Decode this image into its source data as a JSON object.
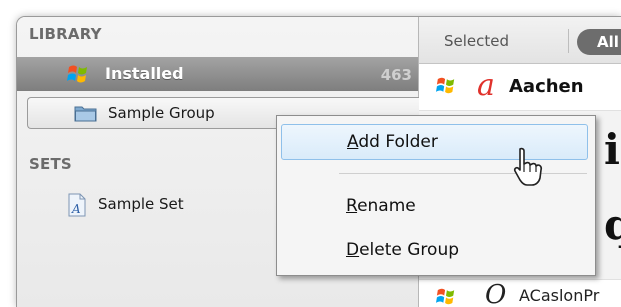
{
  "library": {
    "heading": "LIBRARY",
    "installed": {
      "label": "Installed",
      "count": "463"
    },
    "group": {
      "label": "Sample Group"
    }
  },
  "sets": {
    "heading": "SETS",
    "items": [
      {
        "label": "Sample Set"
      }
    ]
  },
  "toolbar": {
    "selected_label": "Selected",
    "all_label": "All"
  },
  "fonts": [
    {
      "glyph": "a",
      "name": "Aachen"
    },
    {
      "glyph": "O",
      "name": "ACaslonPr"
    }
  ],
  "preview": {
    "line1": "i",
    "line2": "q"
  },
  "context_menu": {
    "items": [
      {
        "mnemonic": "A",
        "rest": "dd Folder",
        "highlighted": true
      },
      {
        "mnemonic": "R",
        "rest": "ename"
      },
      {
        "mnemonic": "D",
        "rest": "elete Group"
      }
    ]
  },
  "colors": {
    "selection_gray": "#8f8f8f",
    "menu_highlight": "#d9ebfa",
    "accent_red": "#e0322c"
  }
}
